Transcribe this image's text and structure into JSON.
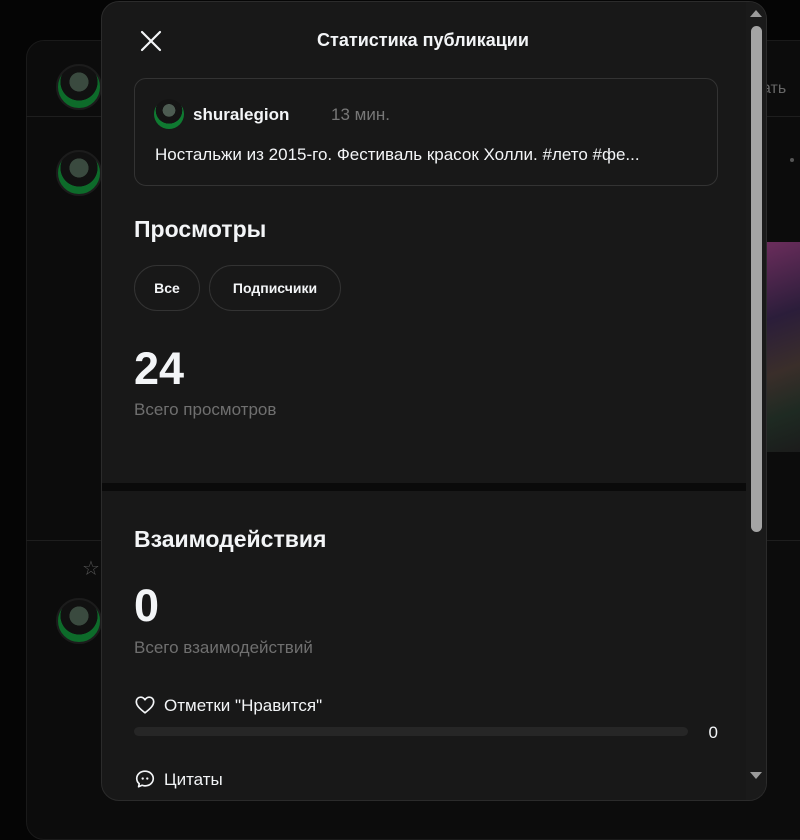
{
  "modal": {
    "title": "Статистика публикации"
  },
  "post": {
    "username": "shuralegion",
    "time": "13 мин.",
    "text": "Ностальжи из 2015-го. Фестиваль красок Холли. #лето #фе..."
  },
  "views": {
    "title": "Просмотры",
    "filters": [
      {
        "label": "Все"
      },
      {
        "label": "Подписчики"
      }
    ],
    "total": "24",
    "total_label": "Всего просмотров"
  },
  "interactions": {
    "title": "Взаимодействия",
    "total": "0",
    "total_label": "Всего взаимодействий",
    "metrics": [
      {
        "label": "Отметки \"Нравится\"",
        "icon": "heart-icon",
        "value": "0",
        "fraction": 0
      },
      {
        "label": "Цитаты",
        "icon": "quote-icon"
      }
    ]
  },
  "background": {
    "edge_text": "ать"
  }
}
